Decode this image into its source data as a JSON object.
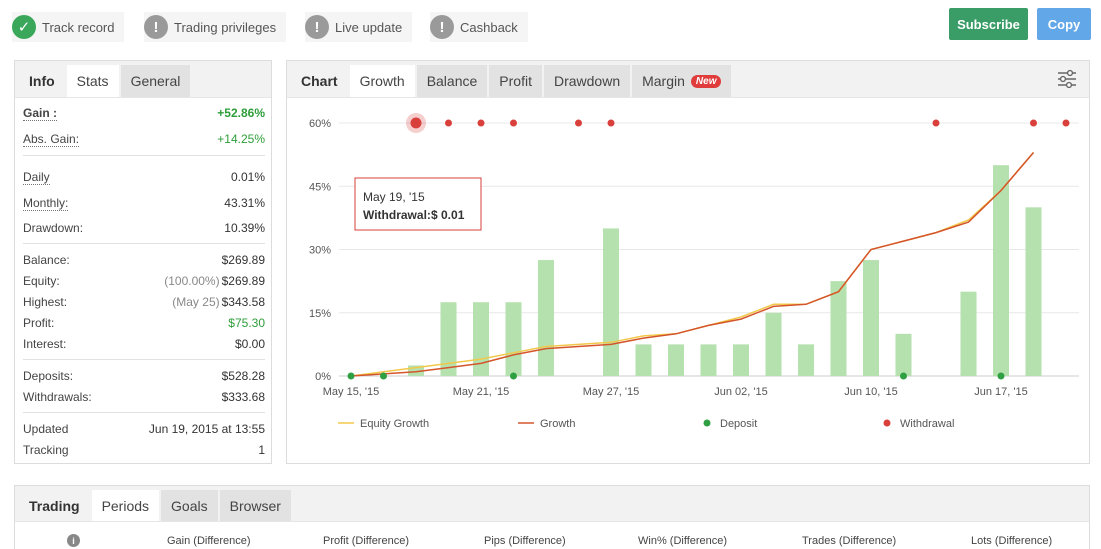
{
  "badges": [
    {
      "label": "Track record",
      "icon": "check-icon",
      "status": "verified",
      "color": "#3aa75a"
    },
    {
      "label": "Trading privileges",
      "icon": "exclamation-icon",
      "status": "unverified",
      "color": "#9a9a9a"
    },
    {
      "label": "Live update",
      "icon": "exclamation-icon",
      "status": "unverified",
      "color": "#9a9a9a"
    },
    {
      "label": "Cashback",
      "icon": "exclamation-icon",
      "status": "unverified",
      "color": "#9a9a9a"
    }
  ],
  "actions": {
    "subscribe": "Subscribe",
    "copy": "Copy"
  },
  "left_tabs": [
    "Info",
    "Stats",
    "General"
  ],
  "stats": {
    "gain": {
      "label": "Gain :",
      "value": "+52.86%"
    },
    "abs_gain": {
      "label": "Abs. Gain:",
      "value": "+14.25%"
    },
    "daily": {
      "label": "Daily",
      "value": "0.01%"
    },
    "monthly": {
      "label": "Monthly:",
      "value": "43.31%"
    },
    "drawdown": {
      "label": "Drawdown:",
      "value": "10.39%"
    },
    "balance": {
      "label": "Balance:",
      "value": "$269.89"
    },
    "equity": {
      "label": "Equity:",
      "prefix": "(100.00%)",
      "value": "$269.89"
    },
    "highest": {
      "label": "Highest:",
      "prefix": "(May 25)",
      "value": "$343.58"
    },
    "profit": {
      "label": "Profit:",
      "value": "$75.30"
    },
    "interest": {
      "label": "Interest:",
      "value": "$0.00"
    },
    "deposits": {
      "label": "Deposits:",
      "value": "$528.28"
    },
    "withdrawals": {
      "label": "Withdrawals:",
      "value": "$333.68"
    },
    "updated": {
      "label": "Updated",
      "value": "Jun 19, 2015 at 13:55"
    },
    "tracking": {
      "label": "Tracking",
      "value": "1"
    }
  },
  "chart_tabs": {
    "title": "Chart",
    "items": [
      "Growth",
      "Balance",
      "Profit",
      "Drawdown",
      "Margin"
    ],
    "new_badge": "New"
  },
  "tooltip": {
    "date": "May 19, '15",
    "label": "Withdrawal:",
    "value": "$ 0.01"
  },
  "chart_data": {
    "type": "bar",
    "ylim": [
      0,
      60
    ],
    "yticks": [
      "0%",
      "15%",
      "30%",
      "45%",
      "60%"
    ],
    "xticks": [
      "May 15, '15",
      "May 21, '15",
      "May 27, '15",
      "Jun 02, '15",
      "Jun 10, '15",
      "Jun 17, '15"
    ],
    "bars": [
      0,
      0,
      2.5,
      17.5,
      17.5,
      17.5,
      27.5,
      0,
      35,
      7.5,
      7.5,
      7.5,
      7.5,
      15,
      7.5,
      22.5,
      27.5,
      10,
      0,
      20,
      50,
      40
    ],
    "equity_growth": [
      0,
      1,
      2,
      3,
      4,
      5.5,
      7,
      7.5,
      8,
      9.5,
      10,
      12,
      14,
      17,
      17,
      20,
      30,
      32,
      34,
      37,
      44,
      53
    ],
    "growth": [
      0,
      0.5,
      1,
      2,
      3,
      5,
      6.5,
      7,
      7.5,
      9,
      10,
      12,
      13.5,
      16.5,
      17,
      20,
      30,
      32,
      34,
      36.5,
      44,
      53
    ],
    "withdrawal_points": [
      2,
      3,
      4,
      5,
      7,
      8,
      18,
      21,
      22
    ],
    "deposit_points": [
      0,
      1,
      5,
      17,
      20
    ],
    "legend": [
      "Equity Growth",
      "Growth",
      "Deposit",
      "Withdrawal"
    ],
    "colors": {
      "bars": "#b5e1ae",
      "equity": "#f2c84b",
      "growth": "#d4552b",
      "deposit": "#2ea043",
      "withdrawal": "#d9403b",
      "grid": "#e8e8e8"
    }
  },
  "bottom_tabs": [
    "Trading",
    "Periods",
    "Goals",
    "Browser"
  ],
  "period_columns": [
    "Gain (Difference)",
    "Profit (Difference)",
    "Pips (Difference)",
    "Win% (Difference)",
    "Trades (Difference)",
    "Lots (Difference)"
  ]
}
